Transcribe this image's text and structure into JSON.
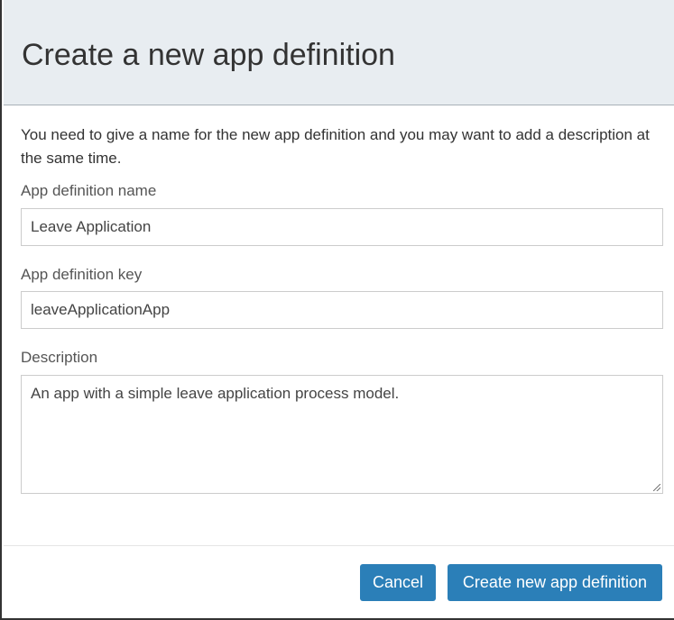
{
  "dialog": {
    "title": "Create a new app definition",
    "intro": "You need to give a name for the new app definition and you may want to add a description at the same time.",
    "fields": {
      "name_label": "App definition name",
      "name_value": "Leave Application",
      "key_label": "App definition key",
      "key_value": "leaveApplicationApp",
      "description_label": "Description",
      "description_value": "An app with a simple leave application process model."
    },
    "buttons": {
      "cancel": "Cancel",
      "create": "Create new app definition"
    },
    "colors": {
      "header_bg": "#e8edf1",
      "primary": "#2b7fb8"
    }
  }
}
